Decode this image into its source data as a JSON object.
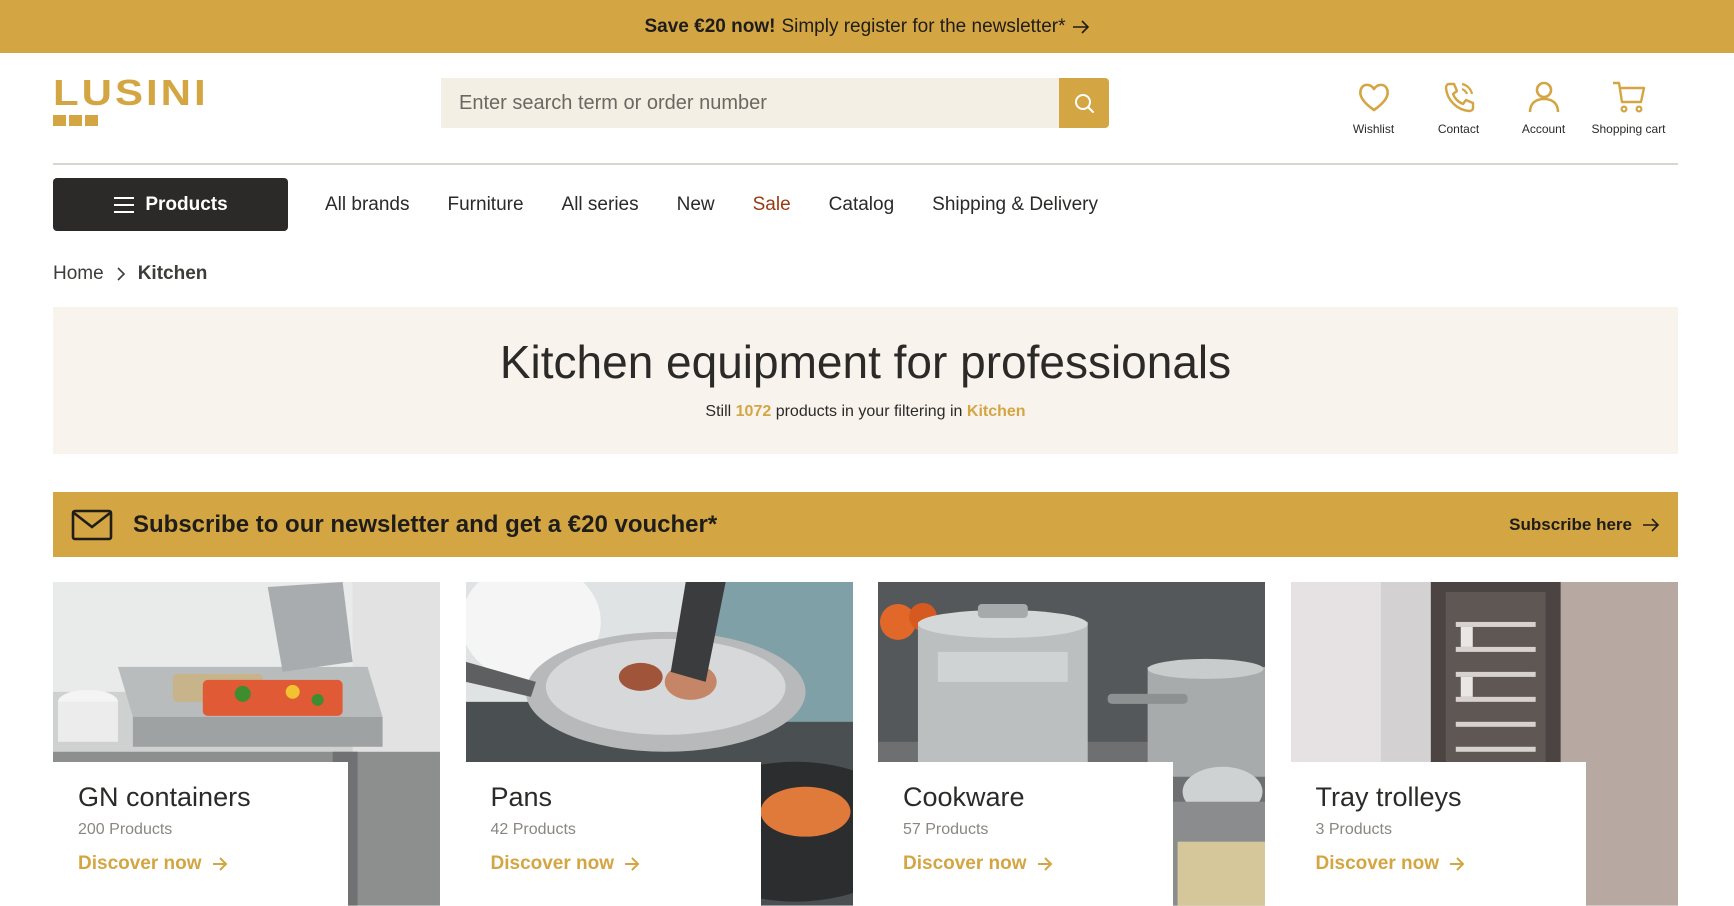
{
  "promo": {
    "bold": "Save €20 now!",
    "text": "Simply register for the newsletter*"
  },
  "logo": {
    "text": "LUSINI"
  },
  "search": {
    "placeholder": "Enter search term or order number"
  },
  "header_icons": [
    {
      "label": "Wishlist",
      "icon": "heart-icon"
    },
    {
      "label": "Contact",
      "icon": "phone-icon"
    },
    {
      "label": "Account",
      "icon": "user-icon"
    },
    {
      "label": "Shopping cart",
      "icon": "cart-icon"
    }
  ],
  "nav": {
    "products_label": "Products",
    "links": [
      "All brands",
      "Furniture",
      "All series",
      "New",
      "Sale",
      "Catalog",
      "Shipping & Delivery"
    ]
  },
  "breadcrumb": {
    "home": "Home",
    "current": "Kitchen"
  },
  "hero": {
    "title": "Kitchen equipment for professionals",
    "prefix": "Still",
    "count": "1072",
    "middle": "products in your filtering in",
    "category": "Kitchen"
  },
  "newsletter": {
    "text": "Subscribe to our newsletter and get a €20 voucher*",
    "link": "Subscribe here"
  },
  "cards": [
    {
      "title": "GN containers",
      "count": "200 Products",
      "cta": "Discover now"
    },
    {
      "title": "Pans",
      "count": "42 Products",
      "cta": "Discover now"
    },
    {
      "title": "Cookware",
      "count": "57 Products",
      "cta": "Discover now"
    },
    {
      "title": "Tray trolleys",
      "count": "3 Products",
      "cta": "Discover now"
    }
  ],
  "colors": {
    "accent": "#d4a543",
    "dark": "#2b2a28",
    "sale": "#9a3a14",
    "hero_bg": "#f8f4ed"
  }
}
